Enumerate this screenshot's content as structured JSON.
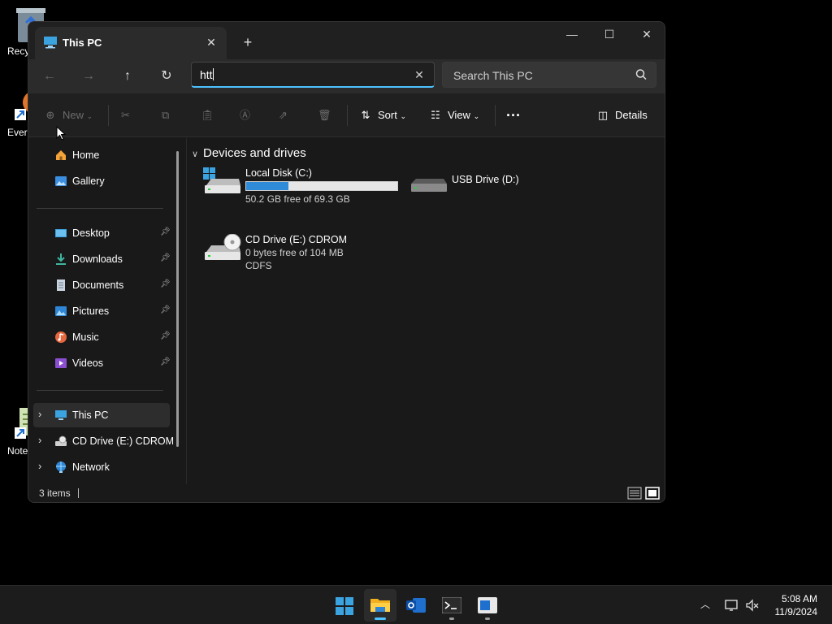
{
  "desktop": {
    "icons": [
      {
        "label": "Recy"
      },
      {
        "label": "Ever"
      },
      {
        "label": "Note"
      }
    ]
  },
  "window": {
    "tab_title": "This PC",
    "address_value": "htt",
    "search_placeholder": "Search This PC"
  },
  "commands": {
    "new": "New",
    "sort": "Sort",
    "view": "View",
    "details": "Details"
  },
  "sidebar": {
    "quick": [
      {
        "label": "Home",
        "icon": "home-icon"
      },
      {
        "label": "Gallery",
        "icon": "gallery-icon"
      }
    ],
    "pinned": [
      {
        "label": "Desktop",
        "icon": "desktop-icon"
      },
      {
        "label": "Downloads",
        "icon": "downloads-icon"
      },
      {
        "label": "Documents",
        "icon": "documents-icon"
      },
      {
        "label": "Pictures",
        "icon": "pictures-icon"
      },
      {
        "label": "Music",
        "icon": "music-icon"
      },
      {
        "label": "Videos",
        "icon": "videos-icon"
      }
    ],
    "locations": [
      {
        "label": "This PC",
        "icon": "this-pc-icon",
        "selected": true
      },
      {
        "label": "CD Drive (E:) CDROM",
        "icon": "cd-drive-icon"
      },
      {
        "label": "Network",
        "icon": "network-icon"
      }
    ]
  },
  "content": {
    "group_title": "Devices and drives",
    "drives": [
      {
        "name": "Local Disk (C:)",
        "free_text": "50.2 GB free of 69.3 GB",
        "used_fraction": 0.28
      },
      {
        "name": "USB Drive (D:)"
      },
      {
        "name": "CD Drive (E:) CDROM",
        "free_text": "0 bytes free of 104 MB",
        "fs_text": "CDFS"
      }
    ]
  },
  "status": {
    "items_text": "3 items"
  },
  "taskbar": {
    "apps": [
      "start-icon",
      "file-explorer-icon",
      "outlook-icon",
      "terminal-icon",
      "app-icon"
    ],
    "time": "5:08 AM",
    "date": "11/9/2024"
  },
  "colors": {
    "accent": "#4cc2ff",
    "usage_bar": "#2f8ad7"
  }
}
